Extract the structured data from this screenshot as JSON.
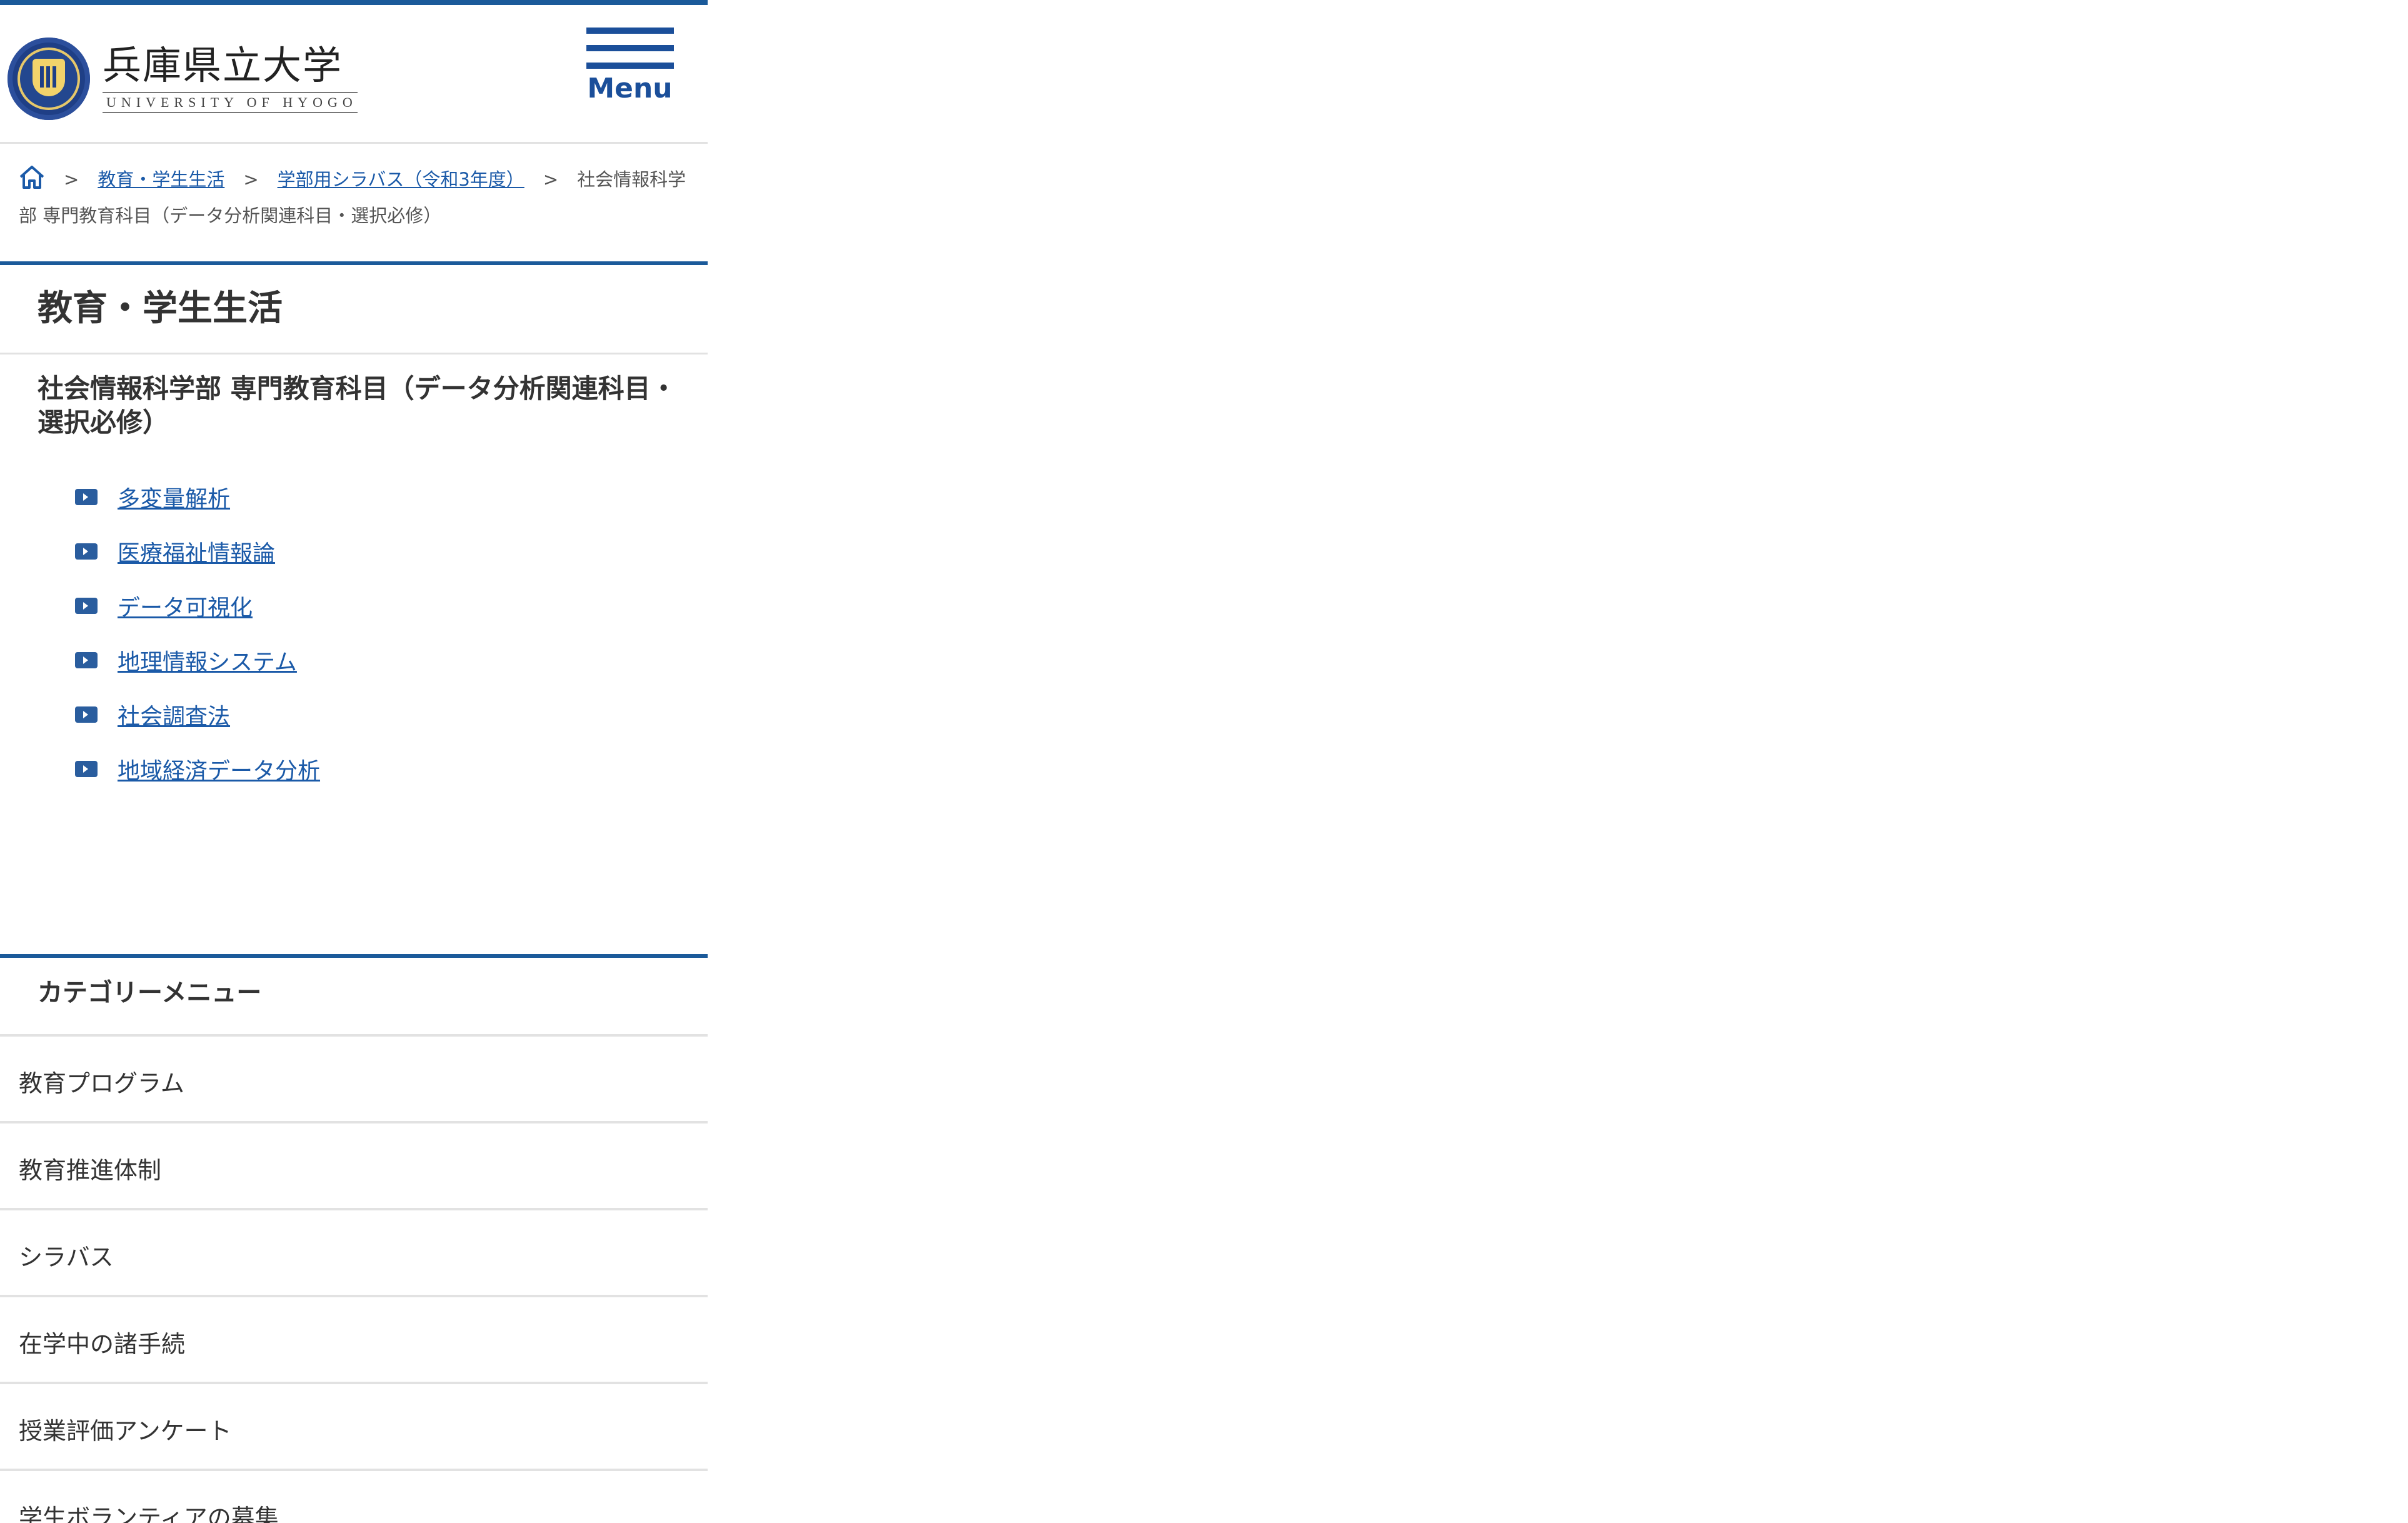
{
  "header": {
    "logo_jp": "兵庫県立大学",
    "logo_en": "UNIVERSITY OF HYOGO",
    "menu_label": "Menu"
  },
  "breadcrumb": {
    "items": [
      "教育・学生生活",
      "学部用シラバス（令和3年度）"
    ],
    "current": "社会情報科学部 専門教育科目（データ分析関連科目・選択必修）",
    "separator": ">"
  },
  "section_title": "教育・学生生活",
  "content_title": "社会情報科学部 専門教育科目（データ分析関連科目・選択必修）",
  "links": [
    "多変量解析",
    "医療福祉情報論",
    "データ可視化",
    "地理情報システム",
    "社会調査法",
    "地域経済データ分析"
  ],
  "category_menu": {
    "title": "カテゴリーメニュー",
    "items": [
      "教育プログラム",
      "教育推進体制",
      "シラバス",
      "在学中の諸手続",
      "授業評価アンケート",
      "学生ボランティアの募集"
    ]
  },
  "colors": {
    "accent": "#1b5a9a",
    "link": "#1b5aa8",
    "divider": "#e2e2e2"
  }
}
